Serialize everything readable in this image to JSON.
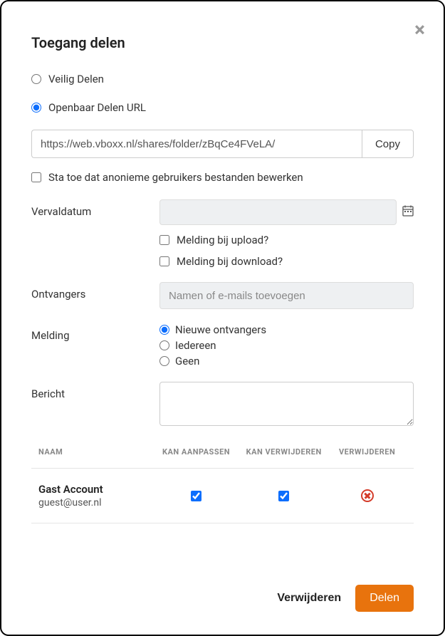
{
  "title": "Toegang delen",
  "share_type": {
    "secure_label": "Veilig Delen",
    "public_label": "Openbaar Delen URL",
    "selected": "public"
  },
  "url": {
    "value": "https://web.vboxx.nl/shares/folder/zBqCe4FVeLA/",
    "copy_label": "Copy"
  },
  "anonymous_edit_label": "Sta toe dat anonieme gebruikers bestanden bewerken",
  "expiry": {
    "label": "Vervaldatum",
    "notify_upload": "Melding bij upload?",
    "notify_download": "Melding bij download?"
  },
  "recipients": {
    "label": "Ontvangers",
    "placeholder": "Namen of e-mails toevoegen"
  },
  "notify": {
    "label": "Melding",
    "new": "Nieuwe ontvangers",
    "all": "Iedereen",
    "none": "Geen"
  },
  "message": {
    "label": "Bericht"
  },
  "table": {
    "headers": {
      "name": "NAAM",
      "edit": "KAN AANPASSEN",
      "del": "KAN VERWIJDEREN",
      "remove": "VERWIJDEREN"
    },
    "rows": [
      {
        "name": "Gast Account",
        "email": "guest@user.nl",
        "can_edit": true,
        "can_delete": true
      }
    ]
  },
  "footer": {
    "delete_label": "Verwijderen",
    "share_label": "Delen"
  }
}
